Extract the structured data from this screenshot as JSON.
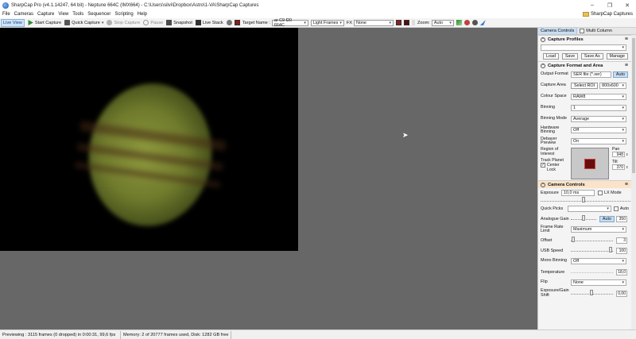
{
  "window": {
    "title": "SharpCap Pro (v4.1.14247, 64 bit) - Neptune 664C (IMX664) - C:\\Users\\silvi\\Dropbox\\Astro\\1-VA\\SharpCap Captures",
    "controls": [
      "–",
      "❐",
      "✕"
    ]
  },
  "menu": {
    "items": [
      "File",
      "Cameras",
      "Capture",
      "View",
      "Tools",
      "Sequencer",
      "Scripting",
      "Help"
    ],
    "captures_link": "SharpCap Captures"
  },
  "toolbar": {
    "live_view": "Live View",
    "start_capture": "Start Capture",
    "quick_capture": "Quick Capture",
    "stop_capture": "Stop Capture",
    "pause": "Pause",
    "snapshot": "Snapshot",
    "live_stack": "Live Stack",
    "target_label": "Target Name :",
    "target_value": "ar C9 f20 664C",
    "frame_type": "Light Frames",
    "fx_label": "FX",
    "fx_value": "None",
    "zoom_label": "Zoom:",
    "zoom_value": "Auto"
  },
  "panel": {
    "tabs": [
      "Camera Controls",
      "Multi Column"
    ],
    "profiles": {
      "title": "Capture Profiles",
      "buttons": [
        "Load",
        "Save",
        "Save As",
        "Manage"
      ]
    },
    "format": {
      "title": "Capture Format and Area",
      "output_format_label": "Output Format",
      "output_format_value": "SER file (*.ser)",
      "auto_label": "Auto",
      "capture_area_label": "Capture Area",
      "select_roi": "Select ROI",
      "capture_area_value": "800x600",
      "colour_space_label": "Colour Space",
      "colour_space_value": "RAW8",
      "binning_label": "Binning",
      "binning_value": "1",
      "binning_mode_label": "Binning Mode",
      "binning_mode_value": "Average",
      "hw_binning_label": "Hardware Binning",
      "hw_binning_value": "Off",
      "debayer_label": "Debayer Preview",
      "debayer_value": "On",
      "roi_label": "Region of Interest",
      "track_planet_label": "Track Planet",
      "center_label": "Center",
      "lock_label": "Lock",
      "pan_label": "Pan",
      "pan_value": "948",
      "tilt_label": "Tilt",
      "tilt_value": "370"
    },
    "camera": {
      "title": "Camera Controls",
      "exposure_label": "Exposure",
      "exposure_value": "10,0 ms",
      "lx_mode_label": "LX Mode",
      "quick_picks_label": "Quick Picks",
      "auto_label": "Auto",
      "analogue_gain_label": "Analogue Gain",
      "analogue_gain_value": "350",
      "frame_rate_label": "Frame Rate Limit",
      "frame_rate_value": "Maximum",
      "offset_label": "Offset",
      "offset_value": "3",
      "usb_speed_label": "USB Speed",
      "usb_speed_value": "100",
      "mono_binning_label": "Mono Binning",
      "mono_binning_value": "Off",
      "temperature_label": "Temperature",
      "temperature_value": "18,0",
      "flip_label": "Flip",
      "flip_value": "None",
      "exp_gain_shift_label": "Exposure/Gain Shift",
      "exp_gain_shift_value": "0,00"
    }
  },
  "status": {
    "preview": "Previewing : 3115 frames (0 dropped) in 0:00:31, 99,6 fps",
    "memory": "Memory: 2 of 20777 frames used, Disk: 1282 GB free"
  },
  "colors": {
    "accent": "#c9ddf2",
    "section_highlight": "#fbe3c9",
    "viewer_bg": "#676767"
  }
}
